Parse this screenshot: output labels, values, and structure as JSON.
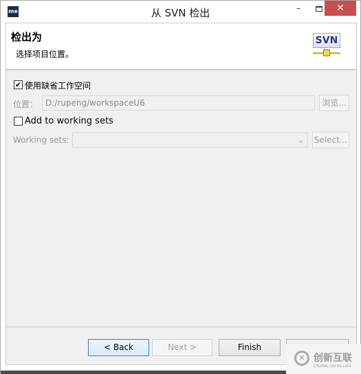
{
  "window": {
    "title": "从 SVN 检出",
    "app_icon_text": "me",
    "minimize": "–",
    "close": "✕"
  },
  "header": {
    "title": "检出为",
    "description": "选择项目位置。",
    "logo_text": "SVN"
  },
  "form": {
    "use_default_workspace": {
      "label": "使用缺省工作空间",
      "checked": true
    },
    "location": {
      "label": "位置：",
      "value": "D:/rupeng/workspaceU6",
      "browse_label": "浏览..."
    },
    "add_to_working_sets": {
      "label": "Add to working sets",
      "checked": false
    },
    "working_sets": {
      "label": "Working sets:",
      "value": "",
      "select_label": "Select..."
    }
  },
  "buttons": {
    "back": "< Back",
    "next": "Next >",
    "finish": "Finish",
    "cancel": ""
  },
  "watermark": {
    "text": "创新互联",
    "subtext": "CHUANG XIN HU LIAN"
  }
}
